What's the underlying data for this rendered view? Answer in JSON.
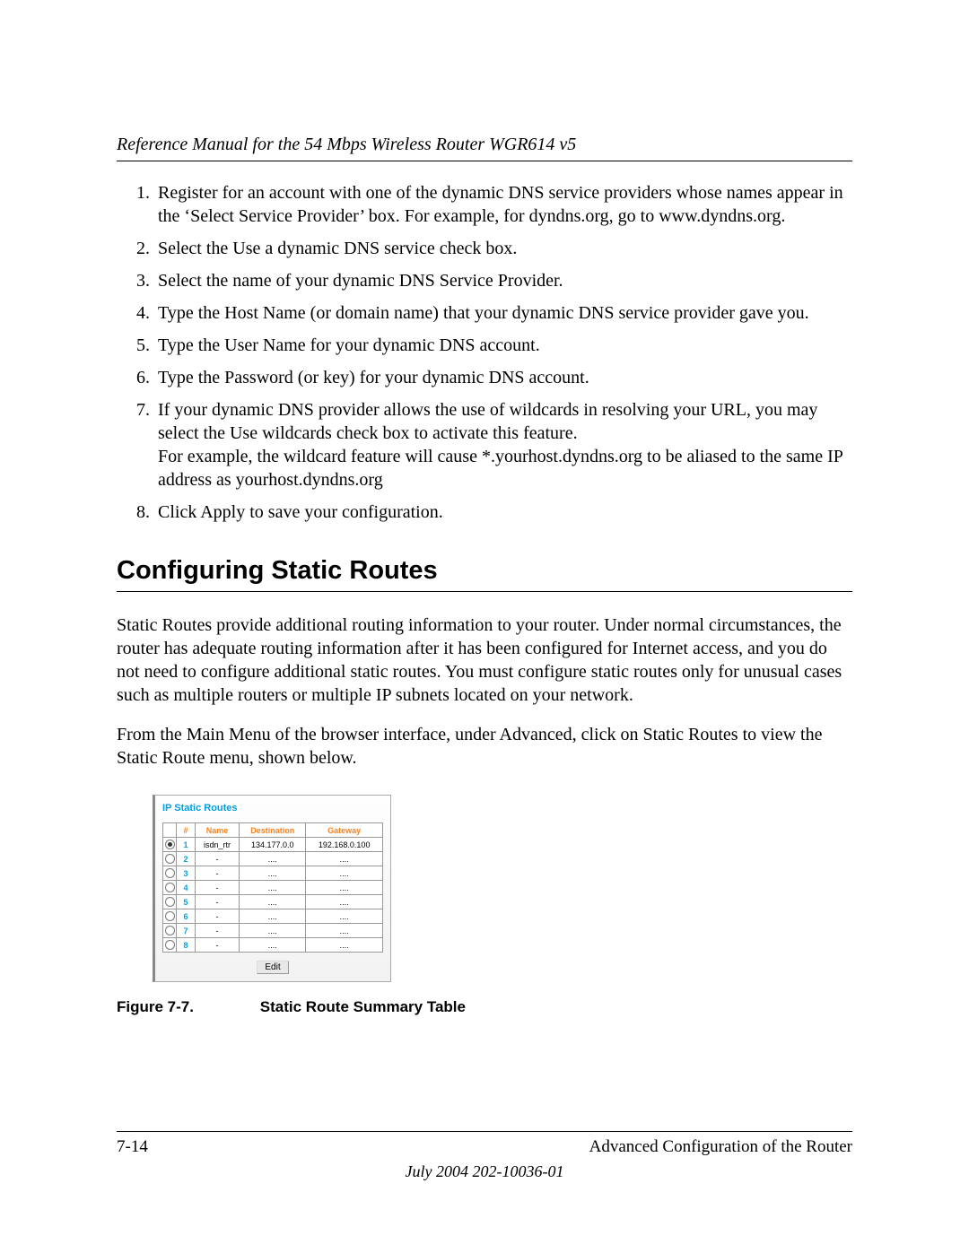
{
  "header": {
    "running_title": "Reference Manual for the 54 Mbps Wireless Router WGR614 v5"
  },
  "steps": [
    "Register for an account with one of the dynamic DNS service providers whose names appear in the ‘Select Service Provider’ box. For example, for dyndns.org, go to www.dyndns.org.",
    "Select the Use a dynamic DNS service check box.",
    "Select the name of your dynamic DNS Service Provider.",
    "Type the Host Name (or domain name) that your dynamic DNS service provider gave you.",
    "Type the User Name for your dynamic DNS account.",
    "Type the Password (or key) for your dynamic DNS account.",
    "If your dynamic DNS provider allows the use of wildcards in resolving your URL, you may select the Use wildcards check box to activate this feature.\nFor example, the wildcard feature will cause *.yourhost.dyndns.org to be aliased to the same IP address as yourhost.dyndns.org",
    "Click Apply to save your configuration."
  ],
  "section_heading": "Configuring Static Routes",
  "para1": "Static Routes provide additional routing information to your router. Under normal circumstances, the router has adequate routing information after it has been configured for Internet access, and you do not need to configure additional static routes. You must configure static routes only for unusual cases such as multiple routers or multiple IP subnets located on your network.",
  "para2": "From the Main Menu of the browser interface, under Advanced, click on Static Routes to view the Static Route menu, shown below.",
  "figure": {
    "panel_title": "IP Static Routes",
    "headers": {
      "num": "#",
      "name": "Name",
      "dest": "Destination",
      "gw": "Gateway"
    },
    "rows": [
      {
        "selected": true,
        "num": "1",
        "name": "isdn_rtr",
        "dest": "134.177.0.0",
        "gw": "192.168.0.100"
      },
      {
        "selected": false,
        "num": "2",
        "name": "-",
        "dest": "....",
        "gw": "...."
      },
      {
        "selected": false,
        "num": "3",
        "name": "-",
        "dest": "....",
        "gw": "...."
      },
      {
        "selected": false,
        "num": "4",
        "name": "-",
        "dest": "....",
        "gw": "...."
      },
      {
        "selected": false,
        "num": "5",
        "name": "-",
        "dest": "....",
        "gw": "...."
      },
      {
        "selected": false,
        "num": "6",
        "name": "-",
        "dest": "....",
        "gw": "...."
      },
      {
        "selected": false,
        "num": "7",
        "name": "-",
        "dest": "....",
        "gw": "...."
      },
      {
        "selected": false,
        "num": "8",
        "name": "-",
        "dest": "....",
        "gw": "...."
      }
    ],
    "edit_label": "Edit"
  },
  "figure_caption": {
    "label": "Figure 7-7.",
    "text": "Static Route Summary Table"
  },
  "footer": {
    "page_num": "7-14",
    "section": "Advanced Configuration of the Router",
    "date_line": "July 2004 202-10036-01"
  }
}
